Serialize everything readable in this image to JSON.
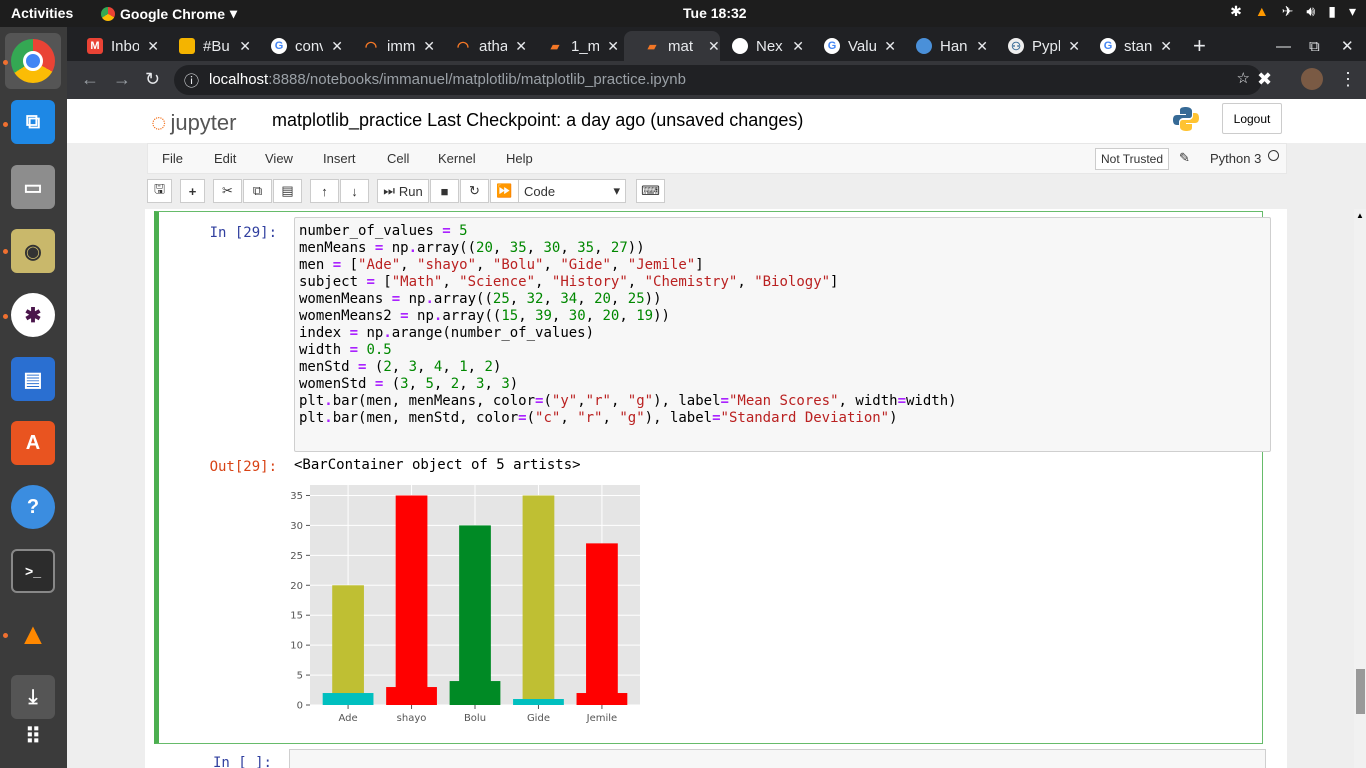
{
  "topbar": {
    "activities": "Activities",
    "app": "Google Chrome",
    "clock": "Tue 18:32"
  },
  "tabs": [
    {
      "label": "Inbo",
      "icon": "gmail-icon",
      "color": "#ea4335"
    },
    {
      "label": "#Bu",
      "icon": "slides-icon",
      "color": "#f4b400"
    },
    {
      "label": "conv",
      "icon": "google-icon",
      "color": "#4285f4"
    },
    {
      "label": "imm",
      "icon": "jupyter-icon",
      "color": "#f37726"
    },
    {
      "label": "atha",
      "icon": "jupyter-icon",
      "color": "#f37726"
    },
    {
      "label": "1_m",
      "icon": "notebook-icon",
      "color": "#f37726"
    },
    {
      "label": "mat",
      "icon": "notebook-icon",
      "color": "#f37726",
      "active": true
    },
    {
      "label": "Nex",
      "icon": "github-icon",
      "color": "#ffffff"
    },
    {
      "label": "Valu",
      "icon": "google-icon",
      "color": "#4285f4"
    },
    {
      "label": "Han",
      "icon": "globe-icon",
      "color": "#4a90d9"
    },
    {
      "label": "Pypl",
      "icon": "python-icon",
      "color": "#ffd43b"
    },
    {
      "label": "stan",
      "icon": "google-icon",
      "color": "#4285f4"
    }
  ],
  "omnibox": {
    "host": "localhost",
    "path": ":8888/notebooks/immanuel/matplotlib/matplotlib_practice.ipynb"
  },
  "jupyter": {
    "logo": "jupyter",
    "title": "matplotlib_practice",
    "checkpoint": "Last Checkpoint: a day ago  (unsaved changes)",
    "logout": "Logout",
    "menu": [
      "File",
      "Edit",
      "View",
      "Insert",
      "Cell",
      "Kernel",
      "Help"
    ],
    "not_trusted": "Not Trusted",
    "kernel": "Python 3",
    "run_label": "Run",
    "cell_type": "Code"
  },
  "cell": {
    "in_prompt": "In [29]:",
    "out_prompt": "Out[29]:",
    "output_text": "<BarContainer object of 5 artists>",
    "next_prompt": "In [ ]:"
  },
  "chart_data": {
    "type": "bar",
    "categories": [
      "Ade",
      "shayo",
      "Bolu",
      "Gide",
      "Jemile"
    ],
    "ylim": [
      0,
      36.75
    ],
    "yticks": [
      0,
      5,
      10,
      15,
      20,
      25,
      30,
      35
    ],
    "grid": true,
    "series": [
      {
        "values": [
          20,
          35,
          30,
          35,
          27
        ],
        "colors": [
          "#bfbf33",
          "#ff0000",
          "#008a25",
          "#bfbf33",
          "#ff0000"
        ],
        "width": 0.5
      },
      {
        "values": [
          2,
          3,
          4,
          1,
          2
        ],
        "colors": [
          "#00bfbf",
          "#ff0000",
          "#008a25",
          "#00bfbf",
          "#ff0000"
        ],
        "width": 0.8
      }
    ]
  }
}
